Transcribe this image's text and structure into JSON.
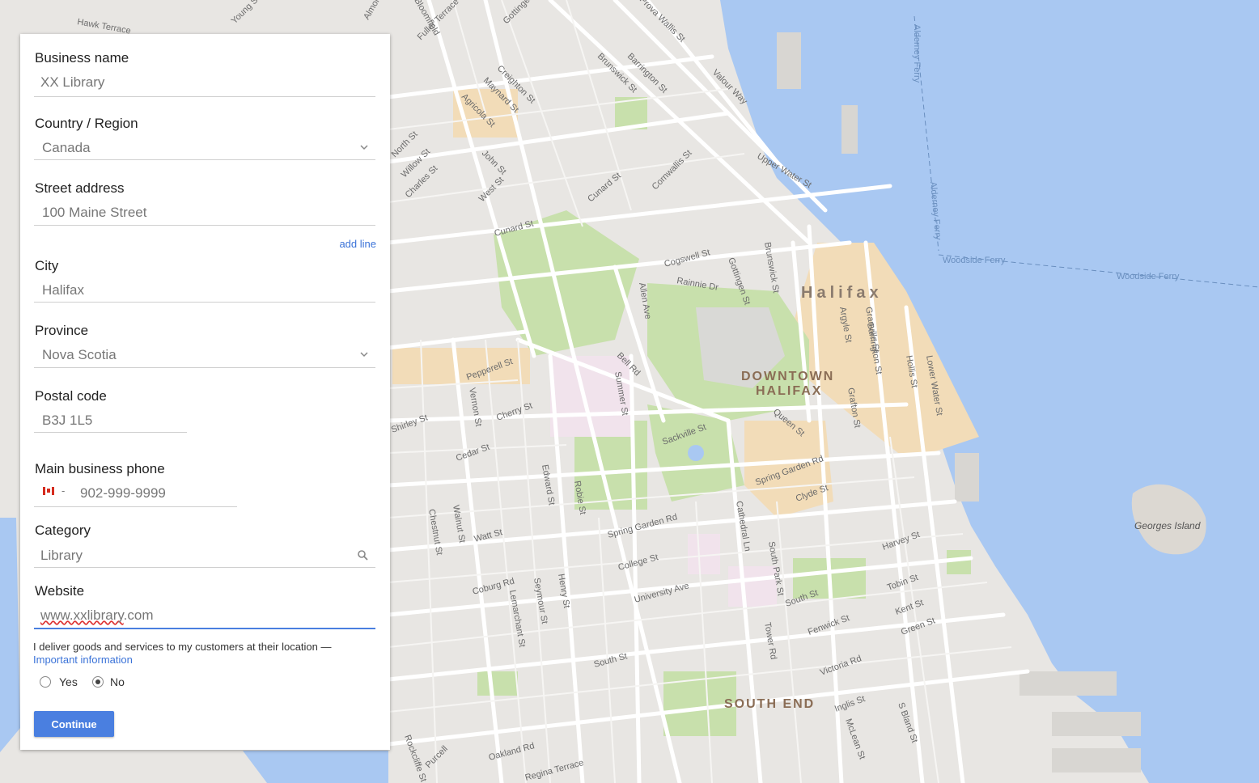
{
  "form": {
    "business_name": {
      "label": "Business name",
      "value": "XX Library"
    },
    "country": {
      "label": "Country / Region",
      "value": "Canada"
    },
    "street": {
      "label": "Street address",
      "value": "100 Maine Street",
      "add_line": "add line"
    },
    "city": {
      "label": "City",
      "value": "Halifax"
    },
    "province": {
      "label": "Province",
      "value": "Nova Scotia"
    },
    "postal": {
      "label": "Postal code",
      "value": "B3J 1L5"
    },
    "phone": {
      "label": "Main business phone",
      "value": "902-999-9999",
      "dash": "-"
    },
    "category": {
      "label": "Category",
      "value": "Library"
    },
    "website": {
      "label": "Website",
      "value_prefix": "www.xxlibrary",
      "value_suffix": ".com"
    },
    "delivery": {
      "text": "I deliver goods and services to my customers at their location —",
      "link": "Important information",
      "yes": "Yes",
      "no": "No",
      "selected": "No"
    },
    "continue": "Continue"
  },
  "map": {
    "city_label": "Halifax",
    "districts": [
      "DOWNTOWN",
      "HALIFAX",
      "SOUTH END"
    ],
    "island": "Georges Island",
    "ferries": [
      "Woodside Ferry",
      "Woodside Ferry",
      "Alderney Ferry",
      "Alderney Ferry"
    ],
    "streets": [
      "Cunard St",
      "Cogswell St",
      "Rainnie Dr",
      "Gottingen St",
      "Brunswick St",
      "Argyle St",
      "Granville St",
      "Barrington St",
      "Hollis St",
      "Lower Water St",
      "Bell Rd",
      "Summer St",
      "Sackville St",
      "Queen St",
      "Grafton St",
      "Spring Garden Rd",
      "Clyde St",
      "Harvey St",
      "Tobin St",
      "Kent St",
      "Green St",
      "Fenwick St",
      "Victoria Rd",
      "South St",
      "Inglis St",
      "McLean St",
      "S Bland St",
      "Tower Rd",
      "South Park St",
      "Cathedral Ln",
      "College St",
      "University Ave",
      "Spring Garden Rd",
      "Robie St",
      "Edward St",
      "Henry St",
      "Seymour St",
      "Lemarchant St",
      "Coburg Rd",
      "Watt St",
      "Walnut St",
      "Chestnut St",
      "Cedar St",
      "Cherry St",
      "Shirley St",
      "Vernon St",
      "Pepperell St",
      "Allen Ave",
      "West St",
      "Willow St",
      "Charles St",
      "North St",
      "Agricola St",
      "John St",
      "Maynard St",
      "Creighton St",
      "Gottingen St",
      "Brunswick St",
      "Barrington St",
      "Valour Way",
      "Upper Water St",
      "Cornwallis St",
      "Cunard St",
      "Oakland Rd",
      "Regina Terrace",
      "South St",
      "Rockcliffe St",
      "Purcell",
      "Fuller Terrace",
      "Bloomfield",
      "Young St",
      "Hawk Terrace",
      "Almon St",
      "Prova Wallis St"
    ],
    "colors": {
      "water": "#a9c8f2",
      "land": "#e8e6e3",
      "park": "#c8e0ac",
      "commercial": "#f2dcb8",
      "road": "#ffffff"
    }
  }
}
